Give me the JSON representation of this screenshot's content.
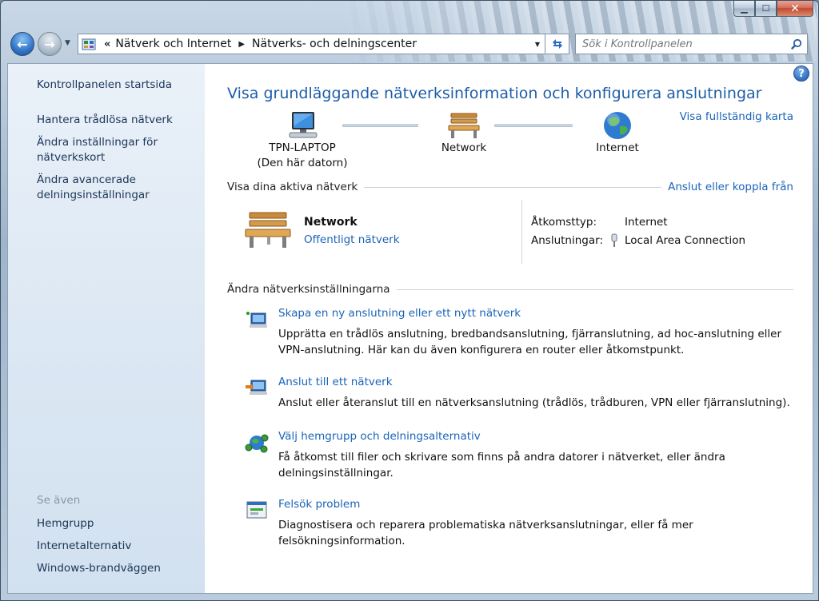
{
  "window": {
    "caption_buttons": {
      "minimize": "▁",
      "maximize": "☐",
      "close": "✕"
    }
  },
  "navbar": {
    "breadcrumb": {
      "overflow": "«",
      "items": [
        "Nätverk och Internet",
        "Nätverks- och delningscenter"
      ],
      "separator": "▶"
    },
    "search_placeholder": "Sök i Kontrollpanelen"
  },
  "sidebar": {
    "top_links": [
      "Kontrollpanelen startsida",
      "Hantera trådlösa nätverk",
      "Ändra inställningar för nätverkskort",
      "Ändra avancerade delningsinställningar"
    ],
    "see_also_heading": "Se även",
    "see_also_links": [
      "Hemgrupp",
      "Internetalternativ",
      "Windows-brandväggen"
    ]
  },
  "main": {
    "title": "Visa grundläggande nätverksinformation och konfigurera anslutningar",
    "full_map_link": "Visa fullständig karta",
    "map": {
      "computer": {
        "name": "TPN-LAPTOP",
        "sub": "(Den här datorn)"
      },
      "network": {
        "name": "Network"
      },
      "internet": {
        "name": "Internet"
      }
    },
    "active_networks": {
      "heading": "Visa dina aktiva nätverk",
      "connect_link": "Anslut eller koppla från",
      "network_name": "Network",
      "network_type": "Offentligt nätverk",
      "access_label": "Åtkomsttyp:",
      "access_value": "Internet",
      "connections_label": "Anslutningar:",
      "connections_value": "Local Area Connection"
    },
    "change_settings": {
      "heading": "Ändra nätverksinställningarna",
      "tasks": [
        {
          "title": "Skapa en ny anslutning eller ett nytt nätverk",
          "desc": "Upprätta en trådlös anslutning, bredbandsanslutning, fjärranslutning, ad hoc-anslutning eller VPN-anslutning. Här kan du även konfigurera en router eller åtkomstpunkt."
        },
        {
          "title": "Anslut till ett nätverk",
          "desc": "Anslut eller återanslut till en nätverksanslutning (trådlös, trådburen, VPN eller fjärranslutning)."
        },
        {
          "title": "Välj hemgrupp och delningsalternativ",
          "desc": "Få åtkomst till filer och skrivare som finns på andra datorer i nätverket, eller ändra delningsinställningar."
        },
        {
          "title": "Felsök problem",
          "desc": "Diagnostisera och reparera problematiska nätverksanslutningar, eller få mer felsökningsinformation."
        }
      ]
    }
  },
  "colors": {
    "link": "#1a64b8",
    "title": "#1e5ea8",
    "sidebar_bg": "#dbe7f3"
  },
  "icons": [
    "back-arrow-icon",
    "forward-arrow-icon",
    "control-panel-icon",
    "refresh-icon",
    "search-icon",
    "help-icon",
    "computer-icon",
    "bench-icon",
    "globe-icon",
    "lan-plug-icon",
    "new-connection-icon",
    "connect-network-icon",
    "homegroup-icon",
    "troubleshoot-icon"
  ]
}
